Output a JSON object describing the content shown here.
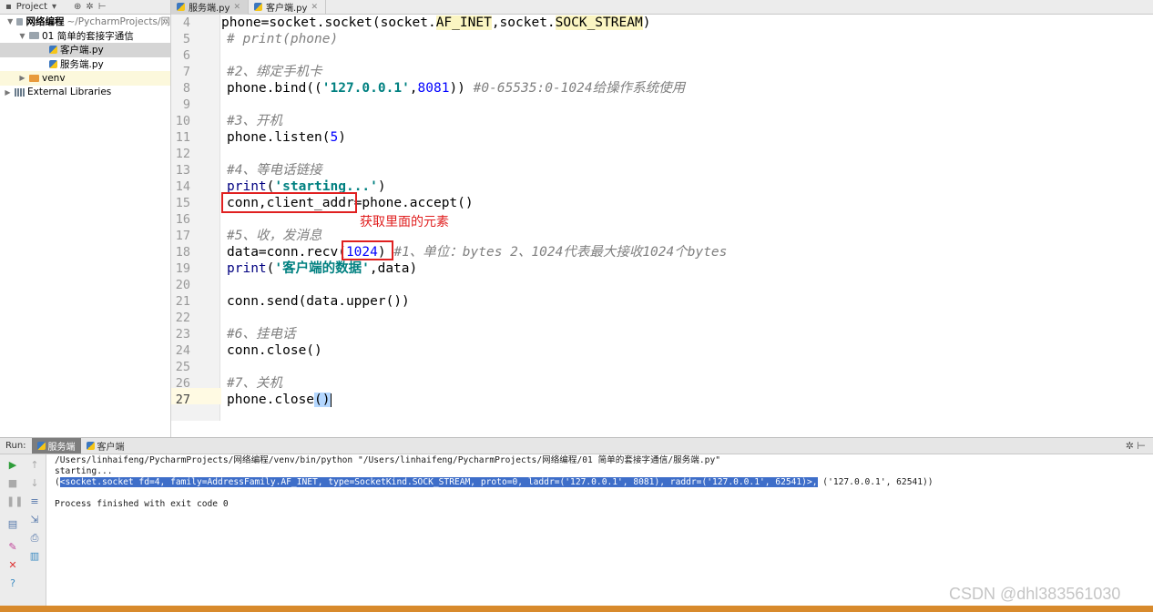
{
  "topbar": {
    "project_label": "Project",
    "tabs": [
      {
        "label": "服务端.py",
        "active": true
      },
      {
        "label": "客户端.py",
        "active": false
      }
    ]
  },
  "tree": [
    {
      "label": "网络编程",
      "suffix": "~/PycharmProjects/网",
      "type": "folder",
      "depth": 0,
      "expanded": true
    },
    {
      "label": "01 简单的套接字通信",
      "type": "folder",
      "depth": 1,
      "expanded": true
    },
    {
      "label": "客户端.py",
      "type": "py",
      "depth": 2,
      "selected": true
    },
    {
      "label": "服务端.py",
      "type": "py",
      "depth": 2
    },
    {
      "label": "venv",
      "type": "venv",
      "depth": 1,
      "expanded": false
    },
    {
      "label": "External Libraries",
      "type": "libs",
      "depth": 0,
      "expanded": false
    }
  ],
  "code": {
    "line_numbers": [
      "4",
      "5",
      "6",
      "7",
      "8",
      "9",
      "10",
      "11",
      "12",
      "13",
      "14",
      "15",
      "16",
      "17",
      "18",
      "19",
      "20",
      "21",
      "22",
      "23",
      "24",
      "25",
      "26",
      "27"
    ],
    "current_line": "27",
    "lines": {
      "l4_a": "phone=socket.socket(socket.",
      "l4_b": "AF_INET",
      "l4_c": ",socket.",
      "l4_d": "SOCK_STREAM",
      "l4_e": ")",
      "l5": "# print(phone)",
      "l7": "#2、绑定手机卡",
      "l8_a": "phone.bind((",
      "l8_b": "'127.0.0.1'",
      "l8_c": ",",
      "l8_d": "8081",
      "l8_e": ")) ",
      "l8_f": "#0-65535:0-1024给操作系统使用",
      "l10": "#3、开机",
      "l11_a": "phone.listen(",
      "l11_b": "5",
      "l11_c": ")",
      "l13": "#4、等电话链接",
      "l14_a": "print",
      "l14_b": "(",
      "l14_c": "'starting...'",
      "l14_d": ")",
      "l15": "conn,client_addr=phone.accept()",
      "l17": "#5、收，发消息",
      "l18_a": "data=conn.recv(",
      "l18_b": "1024",
      "l18_c": ") ",
      "l18_d": "#1、单位：bytes 2、1024代表最大接收1024个bytes",
      "l19_a": "print",
      "l19_b": "(",
      "l19_c": "'客户端的数据'",
      "l19_d": ",data)",
      "l21": "conn.send(data.upper())",
      "l23": "#6、挂电话",
      "l24": "conn.close()",
      "l26": "#7、关机",
      "l27_a": "phone.close",
      "l27_b": "()"
    }
  },
  "annotation": "获取里面的元素",
  "run": {
    "label": "Run:",
    "tabs": [
      {
        "label": "服务端",
        "active": true
      },
      {
        "label": "客户端",
        "active": false
      }
    ],
    "console": {
      "cmd": "/Users/linhaifeng/PycharmProjects/网络编程/venv/bin/python \"/Users/linhaifeng/PycharmProjects/网络编程/01 简单的套接字通信/服务端.py\"",
      "starting": "starting...",
      "socket_open": "(",
      "socket_sel": "<socket.socket fd=4, family=AddressFamily.AF_INET, type=SocketKind.SOCK_STREAM, proto=0, laddr=('127.0.0.1', 8081), raddr=('127.0.0.1', 62541)>,",
      "socket_rest": " ('127.0.0.1', 62541))",
      "finished": "Process finished with exit code 0"
    }
  },
  "watermark": "CSDN @dhl383561030",
  "colors": {
    "accent_red": "#e02020",
    "selection": "#3e6ec9",
    "status_strip": "#d88a2c"
  }
}
